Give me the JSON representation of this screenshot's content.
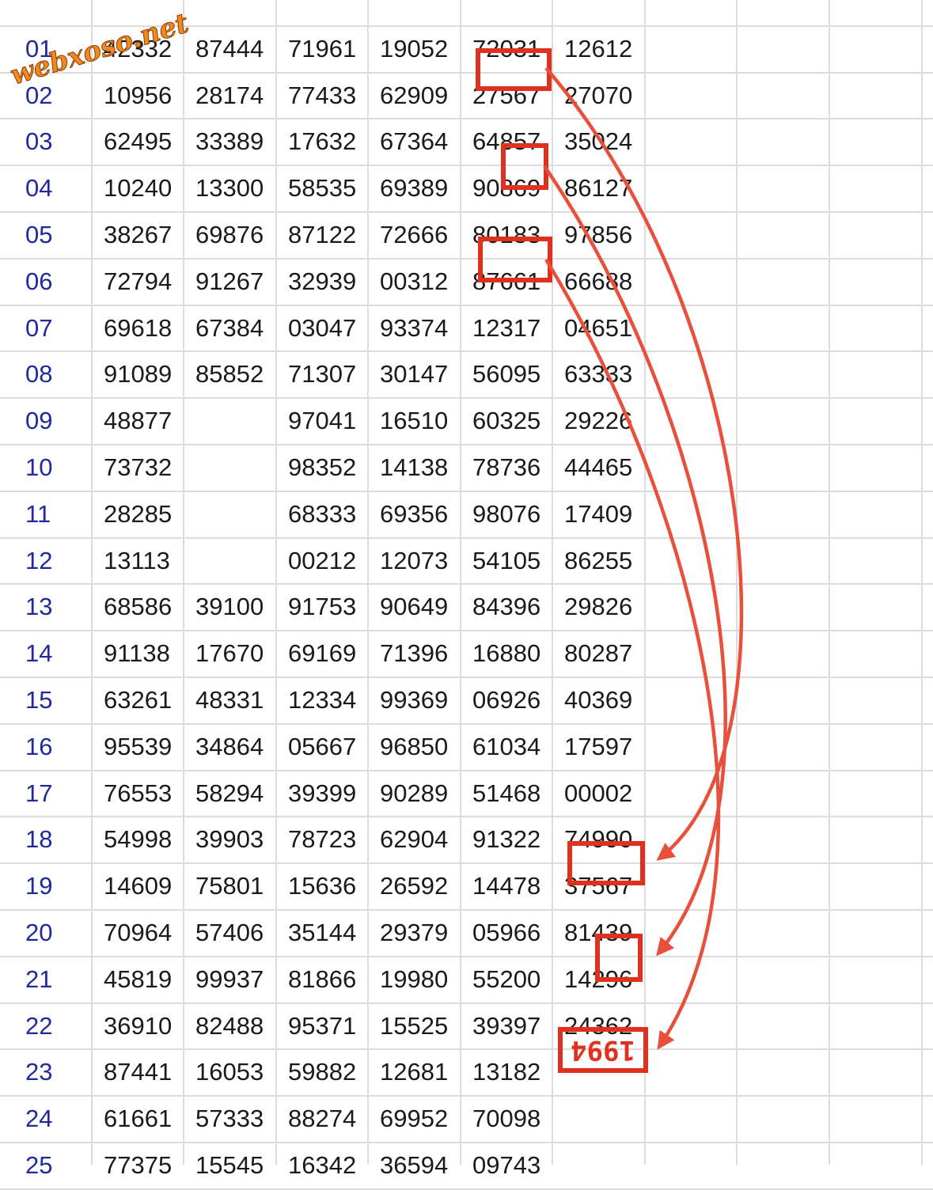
{
  "watermark": "webxoso.net",
  "rows": [
    {
      "label": "01",
      "values": [
        "42332",
        "87444",
        "71961",
        "19052",
        "72031",
        "12612"
      ]
    },
    {
      "label": "02",
      "values": [
        "10956",
        "28174",
        "77433",
        "62909",
        "27567",
        "27070"
      ]
    },
    {
      "label": "03",
      "values": [
        "62495",
        "33389",
        "17632",
        "67364",
        "64857",
        "35024"
      ]
    },
    {
      "label": "04",
      "values": [
        "10240",
        "13300",
        "58535",
        "69389",
        "90869",
        "86127"
      ]
    },
    {
      "label": "05",
      "values": [
        "38267",
        "69876",
        "87122",
        "72666",
        "80183",
        "97856"
      ]
    },
    {
      "label": "06",
      "values": [
        "72794",
        "91267",
        "32939",
        "00312",
        "87661",
        "66688"
      ]
    },
    {
      "label": "07",
      "values": [
        "69618",
        "67384",
        "03047",
        "93374",
        "12317",
        "04651"
      ]
    },
    {
      "label": "08",
      "values": [
        "91089",
        "85852",
        "71307",
        "30147",
        "56095",
        "63333"
      ]
    },
    {
      "label": "09",
      "values": [
        "48877",
        "",
        "97041",
        "16510",
        "60325",
        "29226"
      ]
    },
    {
      "label": "10",
      "values": [
        "73732",
        "",
        "98352",
        "14138",
        "78736",
        "44465"
      ]
    },
    {
      "label": "11",
      "values": [
        "28285",
        "",
        "68333",
        "69356",
        "98076",
        "17409"
      ]
    },
    {
      "label": "12",
      "values": [
        "13113",
        "",
        "00212",
        "12073",
        "54105",
        "86255"
      ]
    },
    {
      "label": "13",
      "values": [
        "68586",
        "39100",
        "91753",
        "90649",
        "84396",
        "29826"
      ]
    },
    {
      "label": "14",
      "values": [
        "91138",
        "17670",
        "69169",
        "71396",
        "16880",
        "80287"
      ]
    },
    {
      "label": "15",
      "values": [
        "63261",
        "48331",
        "12334",
        "99369",
        "06926",
        "40369"
      ]
    },
    {
      "label": "16",
      "values": [
        "95539",
        "34864",
        "05667",
        "96850",
        "61034",
        "17597"
      ]
    },
    {
      "label": "17",
      "values": [
        "76553",
        "58294",
        "39399",
        "90289",
        "51468",
        "00002"
      ]
    },
    {
      "label": "18",
      "values": [
        "54998",
        "39903",
        "78723",
        "62904",
        "91322",
        "74990"
      ]
    },
    {
      "label": "19",
      "values": [
        "14609",
        "75801",
        "15636",
        "26592",
        "14478",
        "37567"
      ]
    },
    {
      "label": "20",
      "values": [
        "70964",
        "57406",
        "35144",
        "29379",
        "05966",
        "81439"
      ]
    },
    {
      "label": "21",
      "values": [
        "45819",
        "99937",
        "81866",
        "19980",
        "55200",
        "14296"
      ]
    },
    {
      "label": "22",
      "values": [
        "36910",
        "82488",
        "95371",
        "15525",
        "39397",
        "24362"
      ]
    },
    {
      "label": "23",
      "values": [
        "87441",
        "16053",
        "59882",
        "12681",
        "13182",
        ""
      ]
    },
    {
      "label": "24",
      "values": [
        "61661",
        "57333",
        "88274",
        "69952",
        "70098",
        ""
      ]
    },
    {
      "label": "25",
      "values": [
        "77375",
        "15545",
        "16342",
        "36594",
        "09743",
        ""
      ]
    }
  ],
  "handwritten_answer": "1994",
  "annotations": {
    "color": "#e0301e",
    "boxes": [
      {
        "row": "02",
        "column": 5,
        "digits": "7567"
      },
      {
        "row": "04",
        "column": 5,
        "digits": "69"
      },
      {
        "row": "06",
        "column": 5,
        "digits": "7661"
      },
      {
        "row": "19",
        "column": 6,
        "digits": "7567"
      },
      {
        "row": "21",
        "column": 6,
        "digits": "96"
      },
      {
        "row": "23",
        "column": 6,
        "digits": "1994"
      }
    ],
    "arrows": [
      {
        "from": "02",
        "to": "19"
      },
      {
        "from": "04",
        "to": "21"
      },
      {
        "from": "06",
        "to": "23"
      }
    ]
  }
}
